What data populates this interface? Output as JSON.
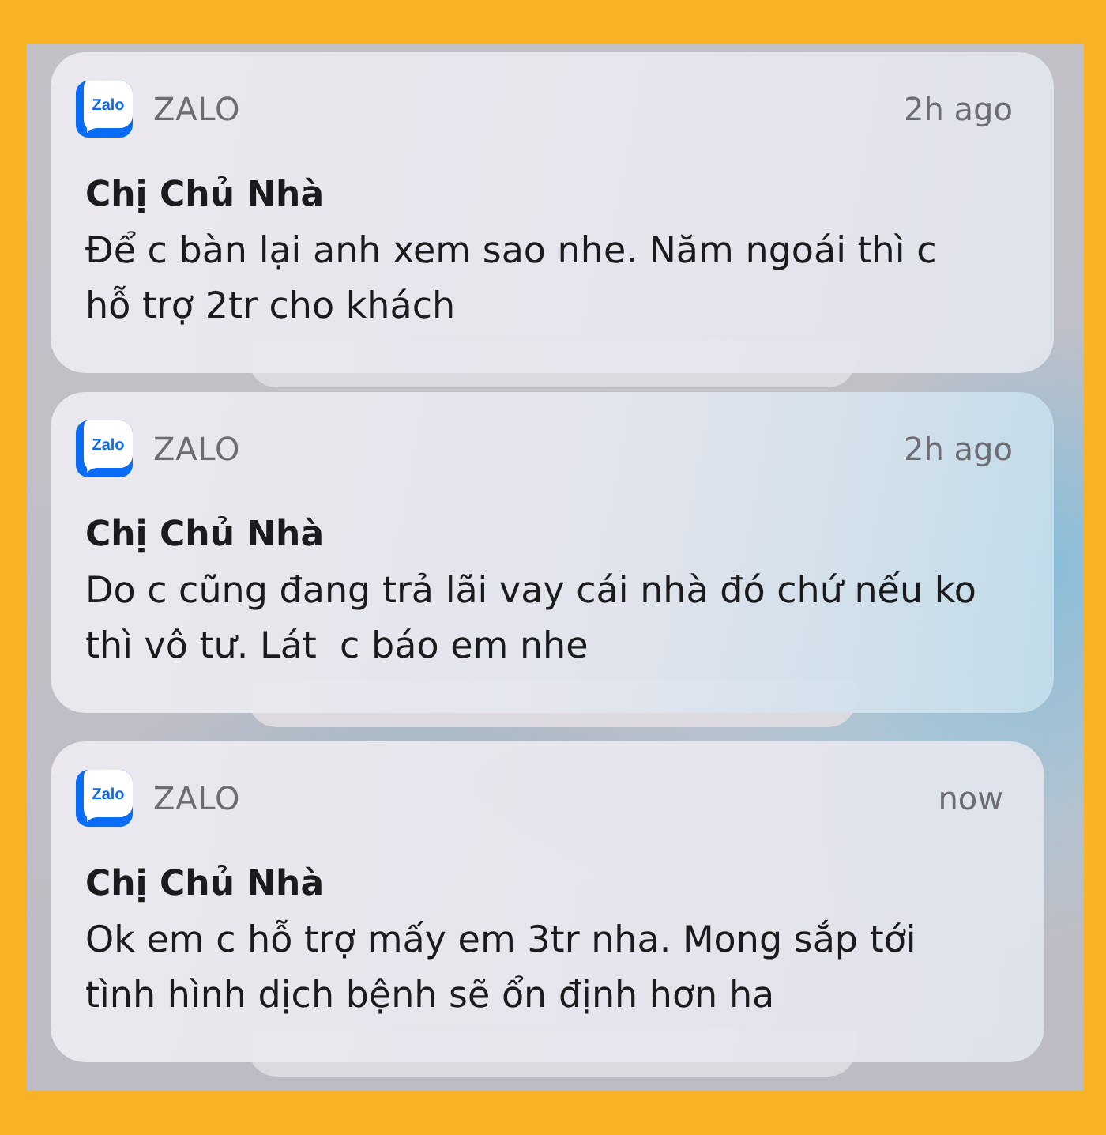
{
  "notifications": [
    {
      "app_icon_text": "Zalo",
      "app_name": "ZALO",
      "time": "2h ago",
      "title": "Chị Chủ Nhà",
      "body": "Để c bàn lại anh xem sao nhe. Năm ngoái thì c hỗ trợ 2tr cho khách",
      "stacked": true
    },
    {
      "app_icon_text": "Zalo",
      "app_name": "ZALO",
      "time": "2h ago",
      "title": "Chị Chủ Nhà",
      "body": "Do c cũng đang trả lãi vay cái nhà đó chứ nếu ko thì vô tư. Lát  c báo em nhe",
      "stacked": true
    },
    {
      "app_icon_text": "Zalo",
      "app_name": "ZALO",
      "time": "now",
      "title": "Chị Chủ Nhà",
      "body": "Ok em c hỗ trợ mấy em 3tr nha. Mong sắp tới tình hình dịch bệnh sẽ ổn định hơn ha",
      "stacked": true
    }
  ]
}
